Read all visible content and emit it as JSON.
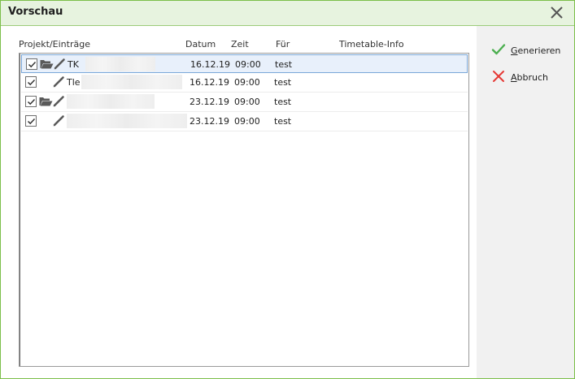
{
  "window": {
    "title": "Vorschau"
  },
  "columns": {
    "project": "Projekt/Einträge",
    "date": "Datum",
    "time": "Zeit",
    "for": "Für",
    "timetable": "Timetable-Info"
  },
  "rows": [
    {
      "name": "TK",
      "date": "16.12.19",
      "time": "09:00",
      "for": "test",
      "checked": true,
      "folder": true,
      "selected": true
    },
    {
      "name": "Tle",
      "date": "16.12.19",
      "time": "09:00",
      "for": "test",
      "checked": true,
      "folder": false,
      "selected": false
    },
    {
      "name": "",
      "date": "23.12.19",
      "time": "09:00",
      "for": "test",
      "checked": true,
      "folder": true,
      "selected": false
    },
    {
      "name": "",
      "date": "23.12.19",
      "time": "09:00",
      "for": "test",
      "checked": true,
      "folder": false,
      "selected": false
    }
  ],
  "actions": {
    "generate": {
      "mnemonic": "G",
      "rest": "enerieren",
      "icon": "check-icon"
    },
    "cancel": {
      "mnemonic": "A",
      "rest": "bbruch",
      "icon": "cross-icon"
    }
  },
  "colors": {
    "accent_border": "#7cbf4a",
    "title_bg": "#e7f3df",
    "check_green": "#4caf50",
    "cancel_red": "#e53935",
    "selection": "#e8f0fb"
  }
}
